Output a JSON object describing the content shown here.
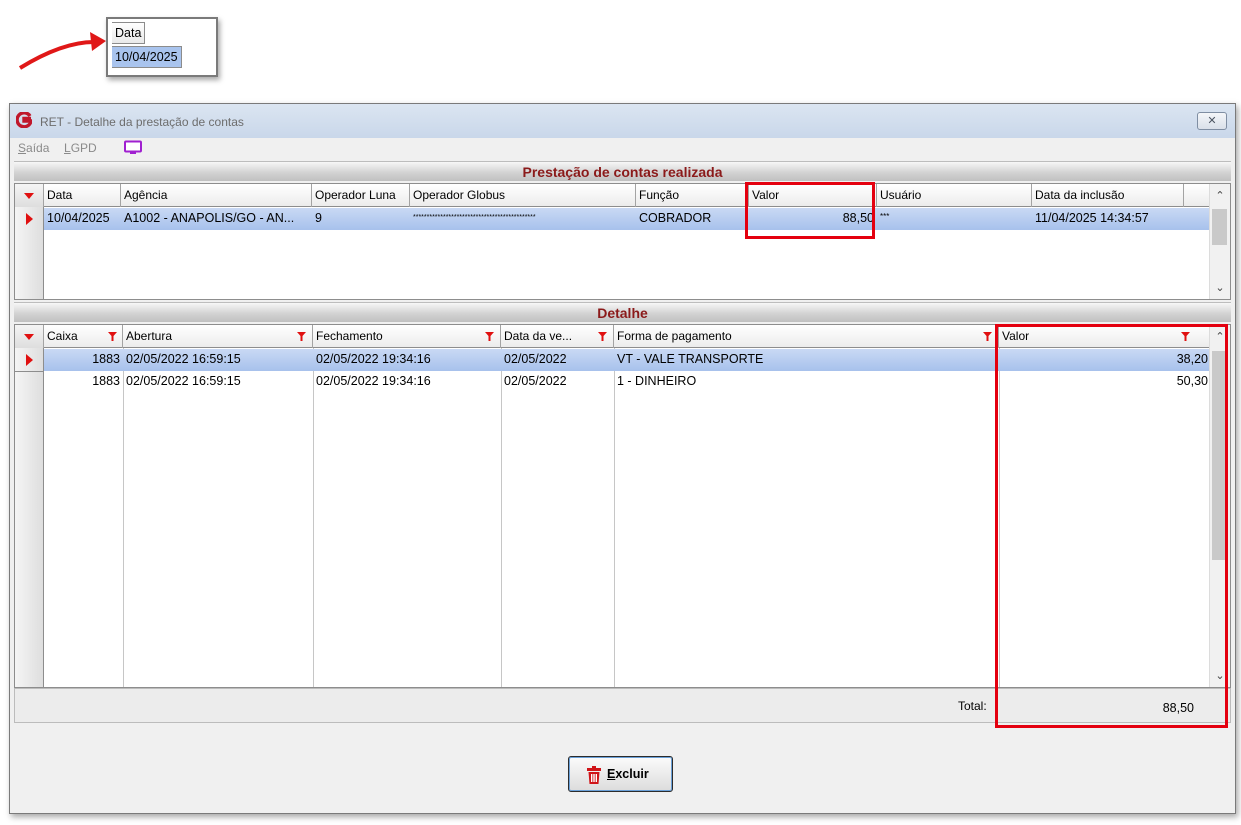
{
  "callout": {
    "header": "Data",
    "value": "10/04/2025"
  },
  "window": {
    "title": "RET - Detalhe da prestação de contas",
    "close_symbol": "✕",
    "menu": [
      {
        "prefix": "",
        "underlined": "S",
        "rest": "aída"
      },
      {
        "prefix": "",
        "underlined": "L",
        "rest": "GPD"
      }
    ]
  },
  "prestacao": {
    "title": "Prestação de contas realizada",
    "columns": [
      "Data",
      "Agência",
      "Operador Luna",
      "Operador Globus",
      "Função",
      "Valor",
      "Usuário",
      "Data da inclusão"
    ],
    "rows": [
      {
        "data": "10/04/2025",
        "agencia": "A1002 - ANAPOLIS/GO - AN...",
        "operador_luna": "9",
        "operador_globus": "*********************************************",
        "funcao": "COBRADOR",
        "valor": "88,50",
        "usuario": "***",
        "data_inclusao": "11/04/2025 14:34:57"
      }
    ]
  },
  "detalhe": {
    "title": "Detalhe",
    "columns": [
      "Caixa",
      "Abertura",
      "Fechamento",
      "Data da ve...",
      "Forma de pagamento",
      "Valor"
    ],
    "rows": [
      {
        "caixa": "1883",
        "abertura": "02/05/2022 16:59:15",
        "fechamento": "02/05/2022 19:34:16",
        "data_venda": "02/05/2022",
        "forma": "VT - VALE TRANSPORTE",
        "valor": "38,20"
      },
      {
        "caixa": "1883",
        "abertura": "02/05/2022 16:59:15",
        "fechamento": "02/05/2022 19:34:16",
        "data_venda": "02/05/2022",
        "forma": "1 - DINHEIRO",
        "valor": "50,30"
      }
    ],
    "total_label": "Total:",
    "total_value": "88,50"
  },
  "actions": {
    "delete_underlined": "E",
    "delete_rest": "xcluir"
  },
  "colors": {
    "highlight": "#e4000f",
    "selected_row": "#a7c1ec",
    "section_title": "#8b1a1a",
    "indicator": "#e01010"
  }
}
